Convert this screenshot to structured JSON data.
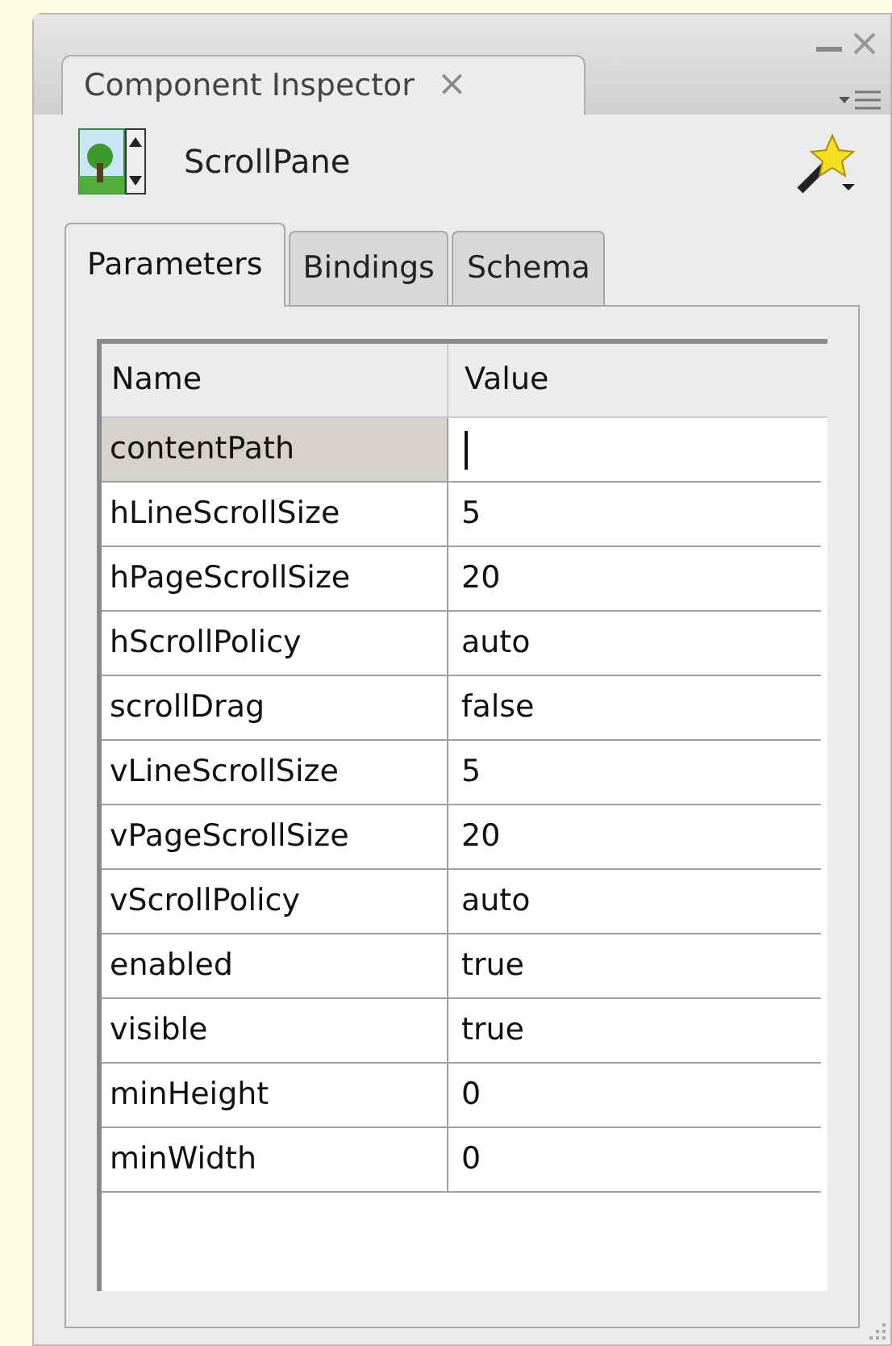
{
  "panel": {
    "title": "Component Inspector",
    "close": "×"
  },
  "component": {
    "name": "ScrollPane"
  },
  "tabs": [
    {
      "label": "Parameters",
      "selected": true
    },
    {
      "label": "Bindings",
      "selected": false
    },
    {
      "label": "Schema",
      "selected": false
    }
  ],
  "table": {
    "columns": [
      "Name",
      "Value"
    ],
    "rows": [
      {
        "name": "contentPath",
        "value": "",
        "selected": true
      },
      {
        "name": "hLineScrollSize",
        "value": "5",
        "selected": false
      },
      {
        "name": "hPageScrollSize",
        "value": "20",
        "selected": false
      },
      {
        "name": "hScrollPolicy",
        "value": "auto",
        "selected": false
      },
      {
        "name": "scrollDrag",
        "value": "false",
        "selected": false
      },
      {
        "name": "vLineScrollSize",
        "value": "5",
        "selected": false
      },
      {
        "name": "vPageScrollSize",
        "value": "20",
        "selected": false
      },
      {
        "name": "vScrollPolicy",
        "value": "auto",
        "selected": false
      },
      {
        "name": "enabled",
        "value": "true",
        "selected": false
      },
      {
        "name": "visible",
        "value": "true",
        "selected": false
      },
      {
        "name": "minHeight",
        "value": "0",
        "selected": false
      },
      {
        "name": "minWidth",
        "value": "0",
        "selected": false
      }
    ]
  }
}
